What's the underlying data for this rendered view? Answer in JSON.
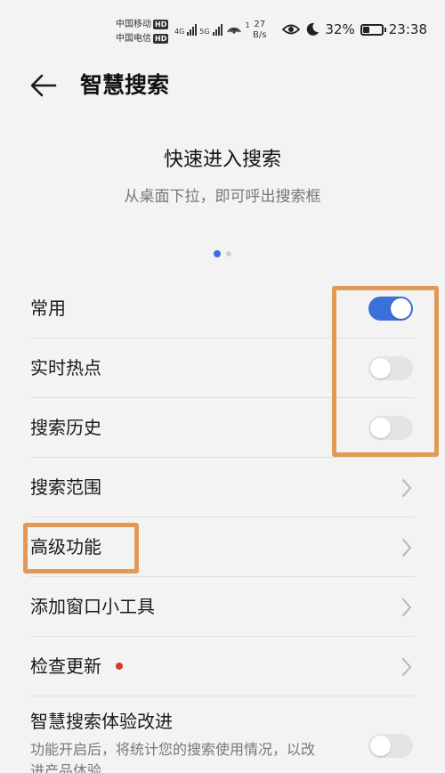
{
  "status_bar": {
    "carrier1": "中国移动",
    "carrier2": "中国电信",
    "hd": "HD",
    "net1": "4G",
    "net2": "5G",
    "hotspot_count": "1",
    "speed_value": "27",
    "speed_unit": "B/s",
    "battery_text": "32%",
    "battery_level": 0.32,
    "time": "23:38",
    "icons": [
      "eye-icon",
      "moon-icon",
      "battery-icon",
      "hotspot-icon"
    ]
  },
  "header": {
    "back_icon": "back-arrow-icon",
    "title": "智慧搜索"
  },
  "hero": {
    "title": "快速进入搜索",
    "subtitle": "从桌面下拉，即可呼出搜索框",
    "pager_total": 2,
    "pager_active": 1
  },
  "list": {
    "toggles": [
      {
        "label": "常用",
        "on": true
      },
      {
        "label": "实时热点",
        "on": false
      },
      {
        "label": "搜索历史",
        "on": false
      }
    ],
    "links": [
      {
        "label": "搜索范围"
      },
      {
        "label": "高级功能"
      },
      {
        "label": "添加窗口小工具"
      },
      {
        "label": "检查更新",
        "badge": "red-dot"
      }
    ],
    "improve": {
      "label": "智慧搜索体验改进",
      "description": "功能开启后，将统计您的搜索使用情况，以改进产品体验",
      "on": false
    }
  },
  "colors": {
    "accent": "#3b6fd9",
    "highlight": "#e09a56",
    "badge": "#d63a2a",
    "background": "#f3f3f3"
  }
}
